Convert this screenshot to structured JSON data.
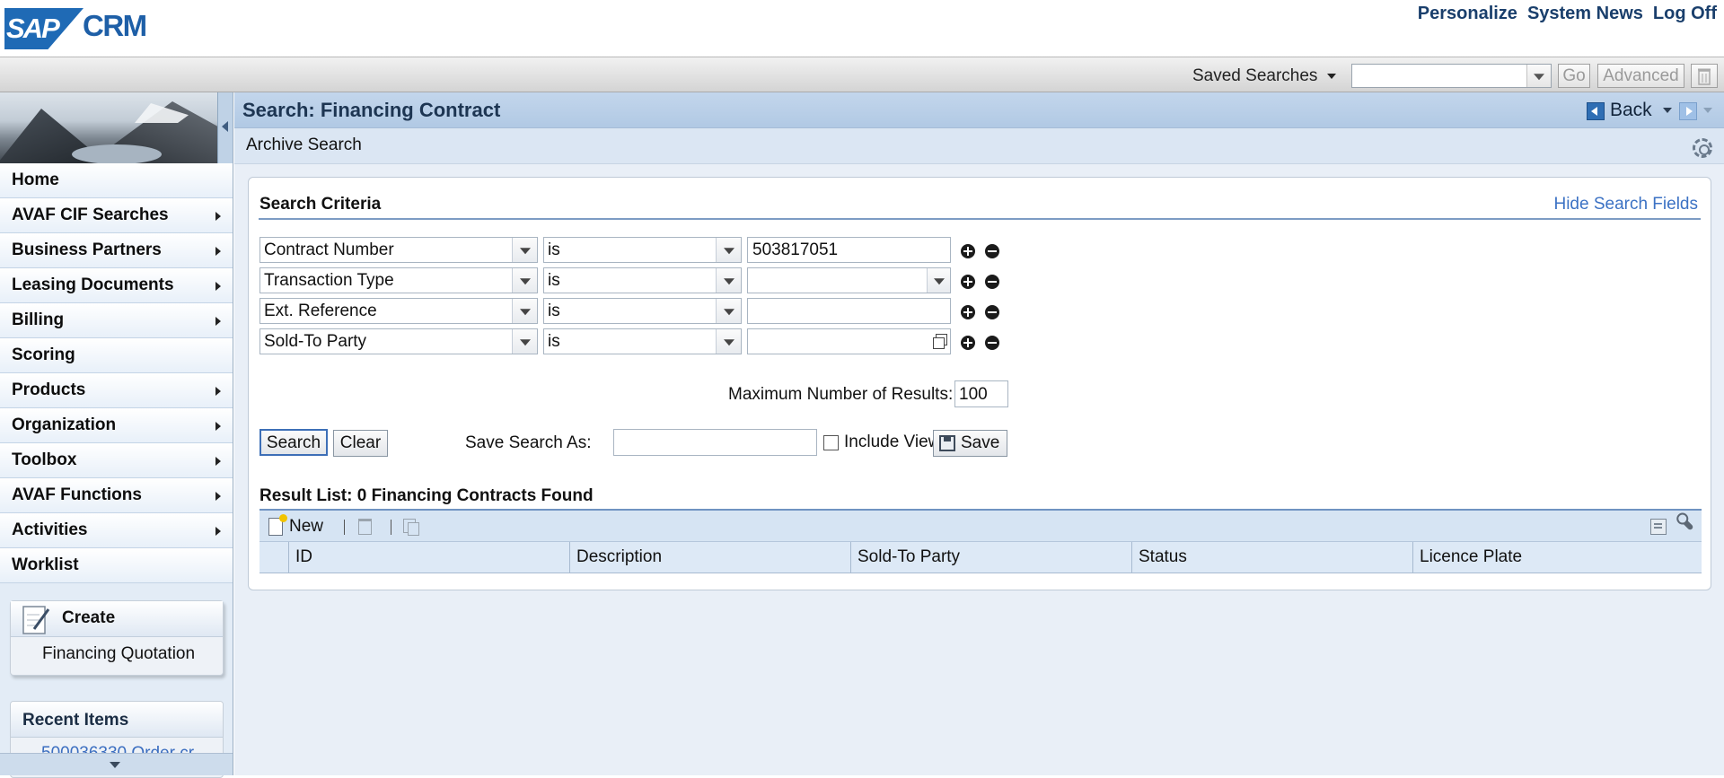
{
  "header": {
    "logo_text_sap": "SAP",
    "logo_text_crm": "CRM",
    "links": [
      "Personalize",
      "System News",
      "Log Off"
    ]
  },
  "topbar": {
    "saved_searches_label": "Saved Searches",
    "saved_searches_value": "",
    "go_label": "Go",
    "advanced_label": "Advanced"
  },
  "nav": {
    "items": [
      {
        "label": "Home",
        "has_submenu": false
      },
      {
        "label": "AVAF CIF Searches",
        "has_submenu": true
      },
      {
        "label": "Business Partners",
        "has_submenu": true
      },
      {
        "label": "Leasing Documents",
        "has_submenu": true
      },
      {
        "label": "Billing",
        "has_submenu": true
      },
      {
        "label": "Scoring",
        "has_submenu": false
      },
      {
        "label": "Products",
        "has_submenu": true
      },
      {
        "label": "Organization",
        "has_submenu": true
      },
      {
        "label": "Toolbox",
        "has_submenu": true
      },
      {
        "label": "AVAF Functions",
        "has_submenu": true
      },
      {
        "label": "Activities",
        "has_submenu": true
      },
      {
        "label": "Worklist",
        "has_submenu": false
      }
    ],
    "create": {
      "title": "Create",
      "link": "Financing Quotation"
    },
    "recent": {
      "title": "Recent Items",
      "first_item": "500036330 Order cr..."
    }
  },
  "main": {
    "title": "Search: Financing Contract",
    "back_label": "Back",
    "subtitle": "Archive Search",
    "criteria": {
      "title": "Search Criteria",
      "hide_link": "Hide Search Fields",
      "rows": [
        {
          "field": "Contract Number",
          "operator": "is",
          "value": "503817051",
          "value_kind": "text"
        },
        {
          "field": "Transaction Type",
          "operator": "is",
          "value": "",
          "value_kind": "dropdown"
        },
        {
          "field": "Ext. Reference",
          "operator": "is",
          "value": "",
          "value_kind": "text"
        },
        {
          "field": "Sold-To Party",
          "operator": "is",
          "value": "",
          "value_kind": "f4"
        }
      ],
      "max_results_label": "Maximum Number of Results:",
      "max_results_value": "100",
      "search_label": "Search",
      "clear_label": "Clear",
      "save_as_label": "Save Search As:",
      "save_as_value": "",
      "include_view_label": "Include View",
      "include_view_checked": false,
      "save_label": "Save"
    },
    "results": {
      "title": "Result List: 0 Financing Contracts Found",
      "new_label": "New",
      "columns": [
        "ID",
        "Description",
        "Sold-To Party",
        "Status",
        "Licence Plate"
      ],
      "rows": []
    }
  },
  "colors": {
    "brand_blue": "#1f6ab5",
    "title_bar": "#b1c9e4",
    "link_blue": "#3c72c4"
  }
}
